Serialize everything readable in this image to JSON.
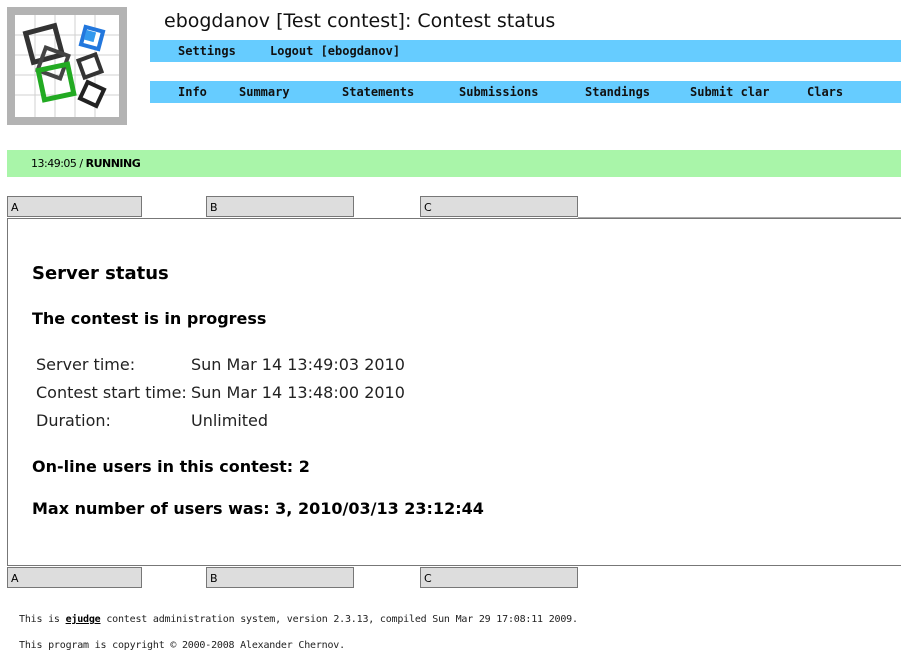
{
  "header": {
    "title": "ebogdanov [Test contest]: Contest status"
  },
  "menu_top": [
    {
      "label": "Settings"
    },
    {
      "label": "Logout [ebogdanov]"
    }
  ],
  "menu_main": [
    {
      "label": "Info"
    },
    {
      "label": "Summary"
    },
    {
      "label": "Statements"
    },
    {
      "label": "Submissions"
    },
    {
      "label": "Standings"
    },
    {
      "label": "Submit clar"
    },
    {
      "label": "Clars"
    }
  ],
  "status": {
    "time": "13:49:05 / ",
    "state": "RUNNING"
  },
  "tabs": [
    "A",
    "B",
    "C"
  ],
  "main": {
    "heading": "Server status",
    "subheading": "The contest is in progress",
    "rows": [
      {
        "label": "Server time:",
        "value": "Sun Mar 14 13:49:03 2010"
      },
      {
        "label": "Contest start time:",
        "value": "Sun Mar 14 13:48:00 2010"
      },
      {
        "label": "Duration:",
        "value": "Unlimited"
      }
    ],
    "online_users": "On-line users in this contest: 2",
    "max_users": "Max number of users was: 3, 2010/03/13 23:12:44"
  },
  "footer": {
    "line1_prefix": "This is ",
    "line1_link": "ejudge",
    "line1_suffix": " contest administration system, version 2.3.13, compiled Sun Mar 29 17:08:11 2009.",
    "line2": "This program is copyright © 2000-2008 Alexander Chernov."
  },
  "colors": {
    "menu": "#66ccff",
    "status": "#a9f5a9",
    "tab": "#dddddd"
  }
}
